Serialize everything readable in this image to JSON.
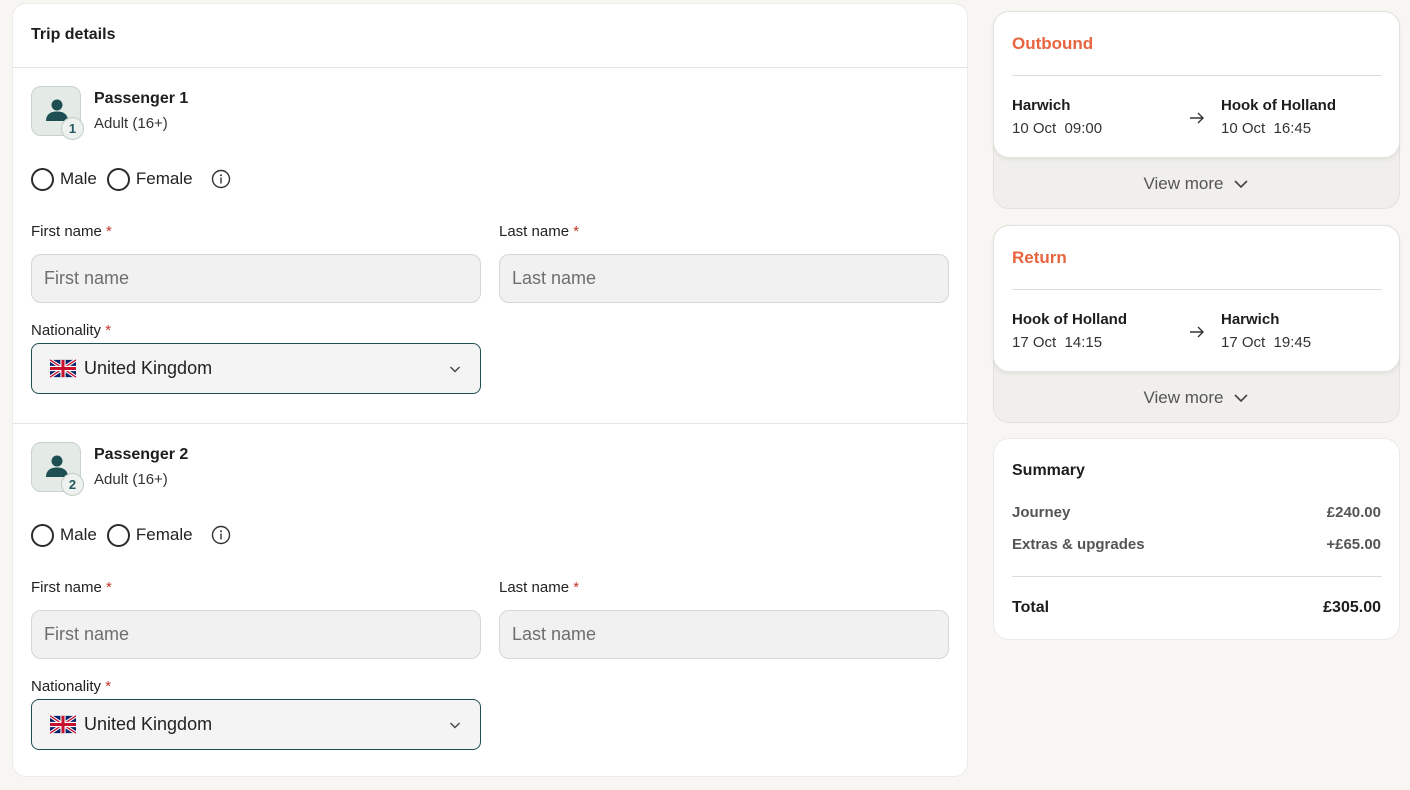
{
  "trip": {
    "title": "Trip details",
    "passengers": [
      {
        "name": "Passenger 1",
        "number": "1",
        "type": "Adult (16+)",
        "gender_options": [
          "Male",
          "Female"
        ],
        "first_name_label": "First name",
        "first_name_placeholder": "First name",
        "last_name_label": "Last name",
        "last_name_placeholder": "Last name",
        "nationality_label": "Nationality",
        "nationality_value": "United Kingdom",
        "required_mark": "*"
      },
      {
        "name": "Passenger 2",
        "number": "2",
        "type": "Adult (16+)",
        "gender_options": [
          "Male",
          "Female"
        ],
        "first_name_label": "First name",
        "first_name_placeholder": "First name",
        "last_name_label": "Last name",
        "last_name_placeholder": "Last name",
        "nationality_label": "Nationality",
        "nationality_value": "United Kingdom",
        "required_mark": "*"
      }
    ]
  },
  "outbound": {
    "title": "Outbound",
    "from_city": "Harwich",
    "from_time": "10 Oct  09:00",
    "to_city": "Hook of Holland",
    "to_time": "10 Oct  16:45",
    "view_more": "View more"
  },
  "return": {
    "title": "Return",
    "from_city": "Hook of Holland",
    "from_time": "17 Oct  14:15",
    "to_city": "Harwich",
    "to_time": "17 Oct  19:45",
    "view_more": "View more"
  },
  "summary": {
    "title": "Summary",
    "rows": [
      {
        "label": "Journey",
        "value": "£240.00"
      },
      {
        "label": "Extras & upgrades",
        "value": "+£65.00"
      }
    ],
    "total_label": "Total",
    "total_value": "£305.00"
  },
  "icons": {
    "avatar": "person-icon",
    "info": "info-icon",
    "chevron": "chevron-down-icon",
    "arrow": "arrow-right-icon",
    "flag": "uk-flag-icon"
  },
  "colors": {
    "accent": "#e8643f",
    "brand_dark": "#1e4f53",
    "required": "#c0392b"
  }
}
